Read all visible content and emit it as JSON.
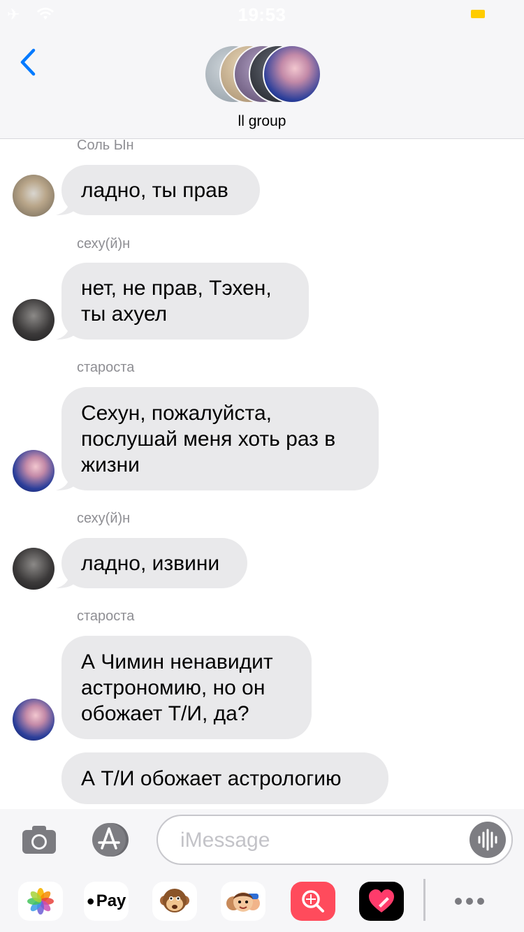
{
  "status_bar": {
    "time": "19:53"
  },
  "header": {
    "group_name": "ll group"
  },
  "messages": [
    {
      "sender": "Соль Ын",
      "text": "ладно, ты прав"
    },
    {
      "sender": "сеху(й)н",
      "text": "нет, не прав, Тэхен,\nты ахуел"
    },
    {
      "sender": "староста",
      "text": "Сехун, пожалуйста,\nпослушай меня хоть раз в\nжизни"
    },
    {
      "sender": "сеху(й)н",
      "text": "ладно, извини"
    },
    {
      "sender": "староста",
      "text": "А Чимин ненавидит\nастрономию, но он\nобожает Т/И, да?"
    },
    {
      "sender": "",
      "text": "А Т/И обожает астрологию"
    }
  ],
  "input": {
    "placeholder": "iMessage",
    "value": ""
  },
  "drawer": {
    "apple_pay_label": "Pay",
    "apps": [
      "photos-icon",
      "apple-pay-icon",
      "animoji-monkey-icon",
      "memoji-icon",
      "image-search-icon",
      "digital-touch-icon",
      "more-icon"
    ]
  },
  "colors": {
    "accent": "#007aff",
    "bubble_gray": "#e9e9eb",
    "sender_gray": "#8e8e93",
    "battery": "#ffcc00"
  }
}
